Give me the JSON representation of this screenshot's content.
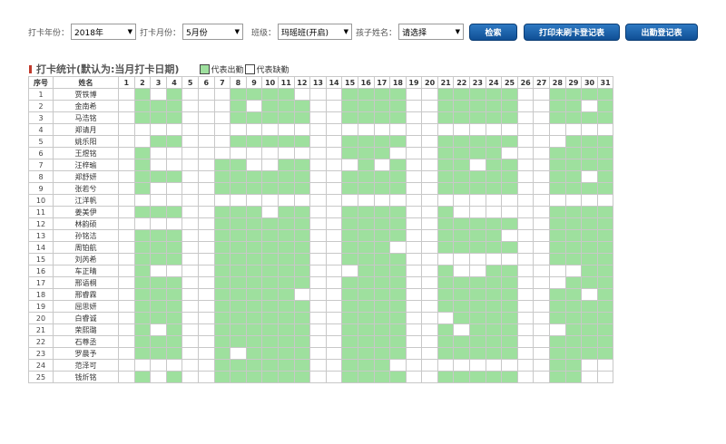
{
  "filters": {
    "year_label": "打卡年份：",
    "year_value": "2018年",
    "month_label": "打卡月份：",
    "month_value": "5月份",
    "class_label": "班级：",
    "class_value": "玛瑶班(开启)",
    "child_label": "孩子姓名：",
    "child_value": "请选择"
  },
  "buttons": {
    "search": "检索",
    "print_missing": "打印未刷卡登记表",
    "attendance": "出勤登记表"
  },
  "section": {
    "title": "打卡统计(默认为:当月打卡日期)",
    "legend_present": "代表出勤",
    "legend_absent": "代表缺勤"
  },
  "colors": {
    "present": "#9ee09e",
    "absent": "#ffffff",
    "button": "#1b5fa8",
    "marker": "#c0392b"
  },
  "table": {
    "headers": {
      "index": "序号",
      "name": "姓名"
    },
    "days": [
      "1",
      "2",
      "3",
      "4",
      "5",
      "6",
      "7",
      "8",
      "9",
      "10",
      "11",
      "12",
      "13",
      "14",
      "15",
      "16",
      "17",
      "18",
      "19",
      "20",
      "21",
      "22",
      "23",
      "24",
      "25",
      "26",
      "27",
      "28",
      "29",
      "30",
      "31"
    ],
    "rows": [
      {
        "no": "1",
        "name": "贾铁博",
        "att": "0101000111100011110011111001111"
      },
      {
        "no": "2",
        "name": "金南希",
        "att": "0111000101110011110011111001101"
      },
      {
        "no": "3",
        "name": "马浩铭",
        "att": "0111000111110011110011111001111"
      },
      {
        "no": "4",
        "name": "郑请月",
        "att": "0000000000000000000000000000000"
      },
      {
        "no": "5",
        "name": "姚乐阳",
        "att": "0011000111110011110011111000111"
      },
      {
        "no": "6",
        "name": "王煜铭",
        "att": "0100000000000011100011110001111"
      },
      {
        "no": "7",
        "name": "汪梓瑜",
        "att": "0100001100110001010011011001111"
      },
      {
        "no": "8",
        "name": "郑舒妍",
        "att": "0111001111110011110011111001101"
      },
      {
        "no": "9",
        "name": "张若兮",
        "att": "0100001111110011110011111001111"
      },
      {
        "no": "10",
        "name": "江洋帆",
        "att": "0000000000000000000000000000000"
      },
      {
        "no": "11",
        "name": "姜美伊",
        "att": "0111001110110011110010000001111"
      },
      {
        "no": "12",
        "name": "林韵硕",
        "att": "0000001111110011110011111001111"
      },
      {
        "no": "13",
        "name": "孙铭洁",
        "att": "0111001111110011110011110001111"
      },
      {
        "no": "14",
        "name": "周铂航",
        "att": "0111001111110011100011111001111"
      },
      {
        "no": "15",
        "name": "刘芮希",
        "att": "0111001111110011110000000001111"
      },
      {
        "no": "16",
        "name": "车正晴",
        "att": "0100001111110001110010011000011"
      },
      {
        "no": "17",
        "name": "邢语桐",
        "att": "0111001111110011110011111000111"
      },
      {
        "no": "18",
        "name": "邢睿霖",
        "att": "0111001111100011110011111001101"
      },
      {
        "no": "19",
        "name": "屈思妍",
        "att": "0111001111110011110011111001111"
      },
      {
        "no": "20",
        "name": "白睿诚",
        "att": "0111001111110011110001111001111"
      },
      {
        "no": "21",
        "name": "荣熙璐",
        "att": "0101001111110011110010111000111"
      },
      {
        "no": "22",
        "name": "石尊丞",
        "att": "0111001111110011110011111001111"
      },
      {
        "no": "23",
        "name": "罗晨予",
        "att": "0111001011110011110011111001111"
      },
      {
        "no": "24",
        "name": "范泽可",
        "att": "0000001111110011100000000001100"
      },
      {
        "no": "25",
        "name": "钱炘铭",
        "att": "0101001111110011110011111001100"
      }
    ]
  }
}
